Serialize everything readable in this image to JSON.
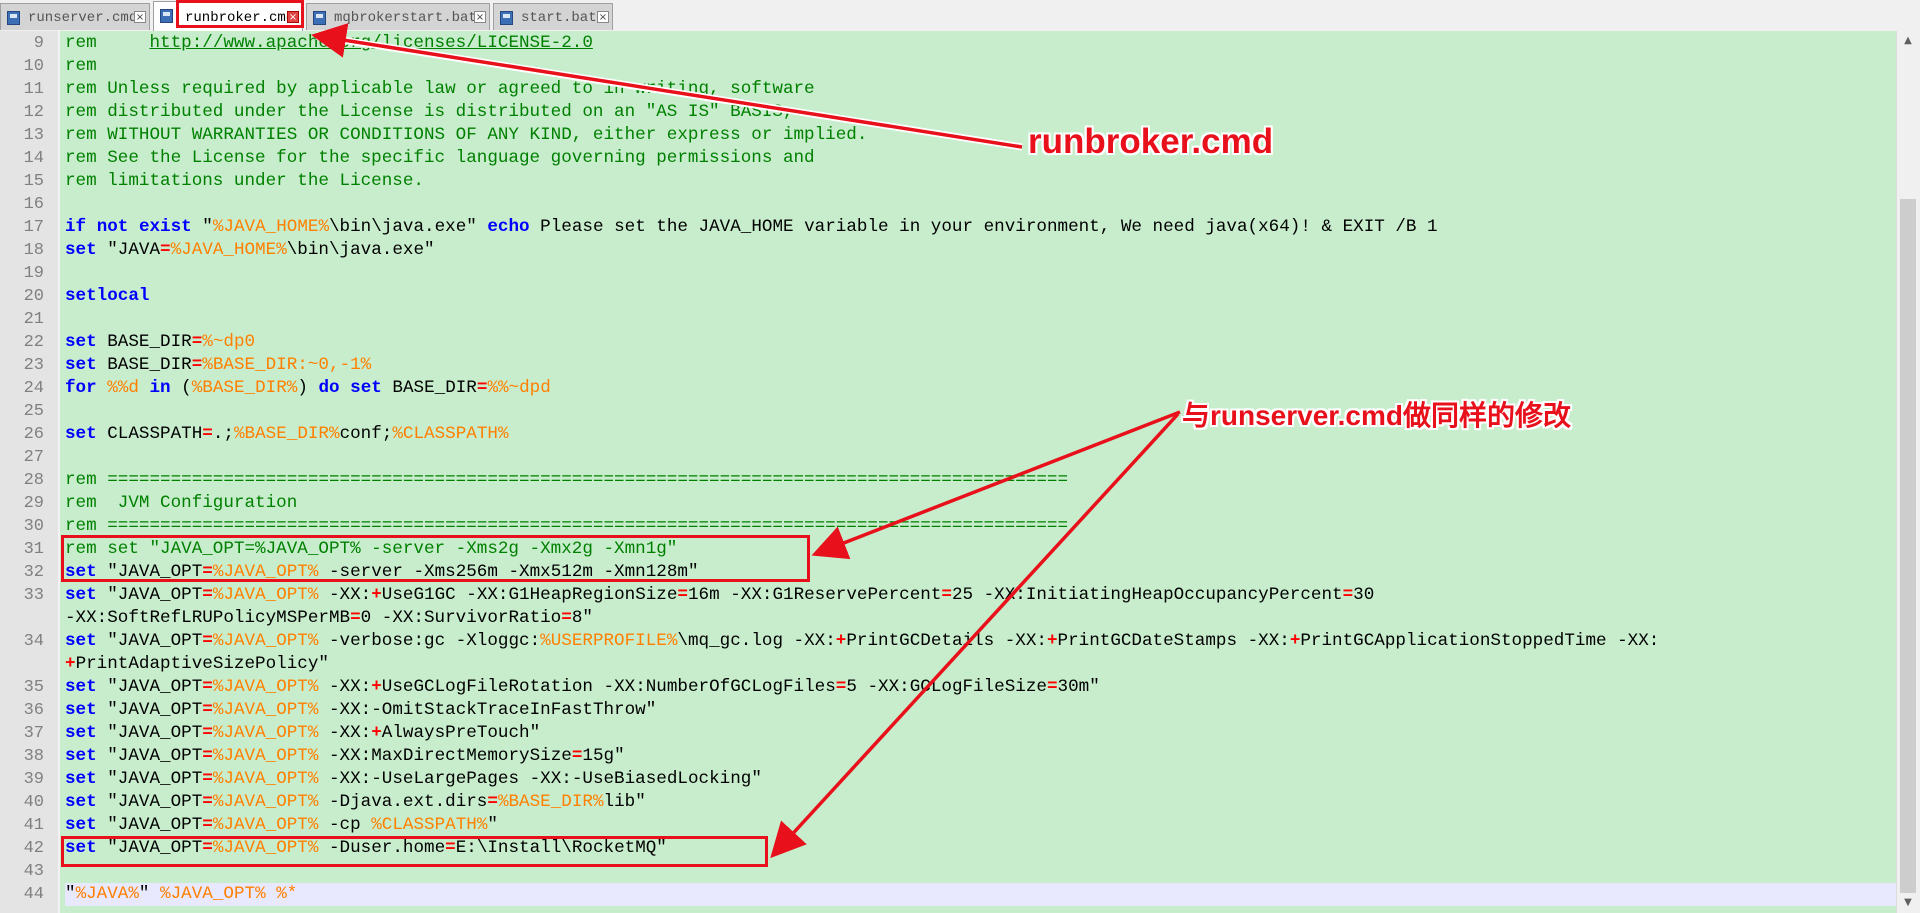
{
  "tabs": [
    {
      "label": "runserver.cmd",
      "close": "×",
      "active": false
    },
    {
      "label": "runbroker.cmd",
      "close": "×",
      "active": true
    },
    {
      "label": "mqbrokerstart.bat",
      "close": "×",
      "active": false
    },
    {
      "label": "start.bat",
      "close": "×",
      "active": false
    }
  ],
  "editor": {
    "line_numbers": [
      "9",
      "10",
      "11",
      "12",
      "13",
      "14",
      "15",
      "16",
      "17",
      "18",
      "19",
      "20",
      "21",
      "22",
      "23",
      "24",
      "25",
      "26",
      "27",
      "28",
      "29",
      "30",
      "31",
      "32",
      "33",
      "",
      "34",
      "",
      "35",
      "36",
      "37",
      "38",
      "39",
      "40",
      "41",
      "42",
      "43",
      "44"
    ],
    "lines": [
      [
        [
          "cm",
          "rem     "
        ],
        [
          "url",
          "http://www.apache.org/licenses/LICENSE-2.0"
        ]
      ],
      [
        [
          "cm",
          "rem"
        ]
      ],
      [
        [
          "cm",
          "rem Unless required by applicable law or agreed to in writing, software"
        ]
      ],
      [
        [
          "cm",
          "rem distributed under the License is distributed on an \"AS IS\" BASIS,"
        ]
      ],
      [
        [
          "cm",
          "rem WITHOUT WARRANTIES OR CONDITIONS OF ANY KIND, either express or implied."
        ]
      ],
      [
        [
          "cm",
          "rem See the License for the specific language governing permissions and"
        ]
      ],
      [
        [
          "cm",
          "rem limitations under the License."
        ]
      ],
      [],
      [
        [
          "kw",
          "if"
        ],
        [
          "t",
          " "
        ],
        [
          "kw",
          "not"
        ],
        [
          "t",
          " "
        ],
        [
          "kw",
          "exist"
        ],
        [
          "t",
          " \""
        ],
        [
          "vr",
          "%JAVA_HOME%"
        ],
        [
          "t",
          "\\bin\\java.exe\" "
        ],
        [
          "kw",
          "echo"
        ],
        [
          "t",
          " Please set the JAVA_HOME variable in your environment, We need java(x64)! & EXIT /B 1"
        ]
      ],
      [
        [
          "kw",
          "set"
        ],
        [
          "t",
          " \"JAVA"
        ],
        [
          "op",
          "="
        ],
        [
          "vr",
          "%JAVA_HOME%"
        ],
        [
          "t",
          "\\bin\\java.exe\""
        ]
      ],
      [],
      [
        [
          "kw",
          "setlocal"
        ]
      ],
      [],
      [
        [
          "kw",
          "set"
        ],
        [
          "t",
          " BASE_DIR"
        ],
        [
          "op",
          "="
        ],
        [
          "vr",
          "%~dp0"
        ]
      ],
      [
        [
          "kw",
          "set"
        ],
        [
          "t",
          " BASE_DIR"
        ],
        [
          "op",
          "="
        ],
        [
          "vr",
          "%BASE_DIR:~0,-1%"
        ]
      ],
      [
        [
          "kw",
          "for"
        ],
        [
          "t",
          " "
        ],
        [
          "vr",
          "%%d"
        ],
        [
          "t",
          " "
        ],
        [
          "kw",
          "in"
        ],
        [
          "t",
          " ("
        ],
        [
          "vr",
          "%BASE_DIR%"
        ],
        [
          "t",
          ") "
        ],
        [
          "kw",
          "do"
        ],
        [
          "t",
          " "
        ],
        [
          "kw",
          "set"
        ],
        [
          "t",
          " BASE_DIR"
        ],
        [
          "op",
          "="
        ],
        [
          "vr",
          "%%~dpd"
        ]
      ],
      [],
      [
        [
          "kw",
          "set"
        ],
        [
          "t",
          " CLASSPATH"
        ],
        [
          "op",
          "="
        ],
        [
          "t",
          ".;"
        ],
        [
          "vr",
          "%BASE_DIR%"
        ],
        [
          "t",
          "conf;"
        ],
        [
          "vr",
          "%CLASSPATH%"
        ]
      ],
      [],
      [
        [
          "cm",
          "rem ==========================================================================================="
        ]
      ],
      [
        [
          "cm",
          "rem  JVM Configuration"
        ]
      ],
      [
        [
          "cm",
          "rem ==========================================================================================="
        ]
      ],
      [
        [
          "cm",
          "rem set \"JAVA_OPT=%JAVA_OPT% -server -Xms2g -Xmx2g -Xmn1g\""
        ]
      ],
      [
        [
          "kw",
          "set"
        ],
        [
          "t",
          " \"JAVA_OPT"
        ],
        [
          "op",
          "="
        ],
        [
          "vr",
          "%JAVA_OPT%"
        ],
        [
          "t",
          " -server -Xms256m -Xmx512m -Xmn128m\""
        ]
      ],
      [
        [
          "kw",
          "set"
        ],
        [
          "t",
          " \"JAVA_OPT"
        ],
        [
          "op",
          "="
        ],
        [
          "vr",
          "%JAVA_OPT%"
        ],
        [
          "t",
          " -XX:"
        ],
        [
          "op",
          "+"
        ],
        [
          "t",
          "UseG1GC -XX:G1HeapRegionSize"
        ],
        [
          "op",
          "="
        ],
        [
          "t",
          "16m -XX:G1ReservePercent"
        ],
        [
          "op",
          "="
        ],
        [
          "t",
          "25 -XX:InitiatingHeapOccupancyPercent"
        ],
        [
          "op",
          "="
        ],
        [
          "t",
          "30"
        ]
      ],
      [
        [
          "t",
          "-XX:SoftRefLRUPolicyMSPerMB"
        ],
        [
          "op",
          "="
        ],
        [
          "t",
          "0 -XX:SurvivorRatio"
        ],
        [
          "op",
          "="
        ],
        [
          "t",
          "8\""
        ]
      ],
      [
        [
          "kw",
          "set"
        ],
        [
          "t",
          " \"JAVA_OPT"
        ],
        [
          "op",
          "="
        ],
        [
          "vr",
          "%JAVA_OPT%"
        ],
        [
          "t",
          " -verbose:gc -Xloggc:"
        ],
        [
          "vr",
          "%USERPROFILE%"
        ],
        [
          "t",
          "\\mq_gc.log -XX:"
        ],
        [
          "op",
          "+"
        ],
        [
          "t",
          "PrintGCDetails -XX:"
        ],
        [
          "op",
          "+"
        ],
        [
          "t",
          "PrintGCDateStamps -XX:"
        ],
        [
          "op",
          "+"
        ],
        [
          "t",
          "PrintGCApplicationStoppedTime -XX:"
        ]
      ],
      [
        [
          "op",
          "+"
        ],
        [
          "t",
          "PrintAdaptiveSizePolicy\""
        ]
      ],
      [
        [
          "kw",
          "set"
        ],
        [
          "t",
          " \"JAVA_OPT"
        ],
        [
          "op",
          "="
        ],
        [
          "vr",
          "%JAVA_OPT%"
        ],
        [
          "t",
          " -XX:"
        ],
        [
          "op",
          "+"
        ],
        [
          "t",
          "UseGCLogFileRotation -XX:NumberOfGCLogFiles"
        ],
        [
          "op",
          "="
        ],
        [
          "t",
          "5 -XX:GCLogFileSize"
        ],
        [
          "op",
          "="
        ],
        [
          "t",
          "30m\""
        ]
      ],
      [
        [
          "kw",
          "set"
        ],
        [
          "t",
          " \"JAVA_OPT"
        ],
        [
          "op",
          "="
        ],
        [
          "vr",
          "%JAVA_OPT%"
        ],
        [
          "t",
          " -XX:-OmitStackTraceInFastThrow\""
        ]
      ],
      [
        [
          "kw",
          "set"
        ],
        [
          "t",
          " \"JAVA_OPT"
        ],
        [
          "op",
          "="
        ],
        [
          "vr",
          "%JAVA_OPT%"
        ],
        [
          "t",
          " -XX:"
        ],
        [
          "op",
          "+"
        ],
        [
          "t",
          "AlwaysPreTouch\""
        ]
      ],
      [
        [
          "kw",
          "set"
        ],
        [
          "t",
          " \"JAVA_OPT"
        ],
        [
          "op",
          "="
        ],
        [
          "vr",
          "%JAVA_OPT%"
        ],
        [
          "t",
          " -XX:MaxDirectMemorySize"
        ],
        [
          "op",
          "="
        ],
        [
          "t",
          "15g\""
        ]
      ],
      [
        [
          "kw",
          "set"
        ],
        [
          "t",
          " \"JAVA_OPT"
        ],
        [
          "op",
          "="
        ],
        [
          "vr",
          "%JAVA_OPT%"
        ],
        [
          "t",
          " -XX:-UseLargePages -XX:-UseBiasedLocking\""
        ]
      ],
      [
        [
          "kw",
          "set"
        ],
        [
          "t",
          " \"JAVA_OPT"
        ],
        [
          "op",
          "="
        ],
        [
          "vr",
          "%JAVA_OPT%"
        ],
        [
          "t",
          " -Djava.ext.dirs"
        ],
        [
          "op",
          "="
        ],
        [
          "vr",
          "%BASE_DIR%"
        ],
        [
          "t",
          "lib\""
        ]
      ],
      [
        [
          "kw",
          "set"
        ],
        [
          "t",
          " \"JAVA_OPT"
        ],
        [
          "op",
          "="
        ],
        [
          "vr",
          "%JAVA_OPT%"
        ],
        [
          "t",
          " -cp "
        ],
        [
          "vr",
          "%CLASSPATH%"
        ],
        [
          "t",
          "\""
        ]
      ],
      [
        [
          "kw",
          "set"
        ],
        [
          "t",
          " \"JAVA_OPT"
        ],
        [
          "op",
          "="
        ],
        [
          "vr",
          "%JAVA_OPT%"
        ],
        [
          "t",
          " -Duser.home"
        ],
        [
          "op",
          "="
        ],
        [
          "t",
          "E:\\Install\\RocketMQ\""
        ]
      ],
      [],
      [
        [
          "t",
          "\""
        ],
        [
          "vr",
          "%JAVA%"
        ],
        [
          "t",
          "\" "
        ],
        [
          "vr",
          "%JAVA_OPT%"
        ],
        [
          "t",
          " "
        ],
        [
          "vr",
          "%*"
        ]
      ]
    ]
  },
  "annotations": {
    "tab_callout": "runbroker.cmd",
    "modify_callout": "与runserver.cmd做同样的修改",
    "color": "#e8101a"
  },
  "scrollbar": {
    "up": "▲",
    "down": "▼"
  }
}
